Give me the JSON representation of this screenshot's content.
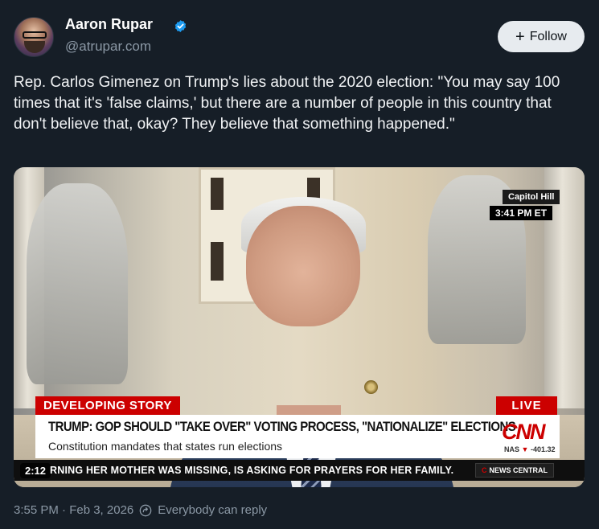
{
  "author": {
    "name": "Aaron Rupar",
    "handle": "@atrupar.com",
    "verified": true,
    "avatar_icon": "avatar-photo",
    "verified_icon": "verified-badge-icon",
    "verified_color": "#1d9bf0"
  },
  "follow_button": {
    "label": "Follow",
    "icon": "plus-icon"
  },
  "post": {
    "text": "Rep. Carlos Gimenez on Trump's lies about the 2020 election: \"You may say 100 times that it's 'false claims,' but there are a number of people in this country that don't believe that, okay? They believe that something happened.\""
  },
  "media": {
    "duration": "2:12",
    "location_tag": "Capitol Hill",
    "time_tag": "3:41 PM ET",
    "developing_label": "DEVELOPING STORY",
    "live_label": "LIVE",
    "headline": "TRUMP: GOP SHOULD \"TAKE OVER\" VOTING PROCESS, \"NATIONALIZE\" ELECTIONS",
    "subheadline": "Constitution mandates that states run elections",
    "network_logo": "CNN",
    "market_ticker": {
      "index": "NAS",
      "value": "-401.32",
      "direction": "down",
      "color": "#cc0000"
    },
    "ticker_text": "RNING HER MOTHER WAS MISSING, IS ASKING FOR PRAYERS FOR HER FAMILY.",
    "news_central_label": "NEWS CENTRAL"
  },
  "footer": {
    "timestamp": "3:55 PM · Feb 3, 2026",
    "reply_setting": "Everybody can reply",
    "reply_icon": "reply-settings-icon"
  },
  "colors": {
    "background": "#161e27",
    "secondary_text": "#8b98a5",
    "cnn_red": "#cc0000"
  }
}
